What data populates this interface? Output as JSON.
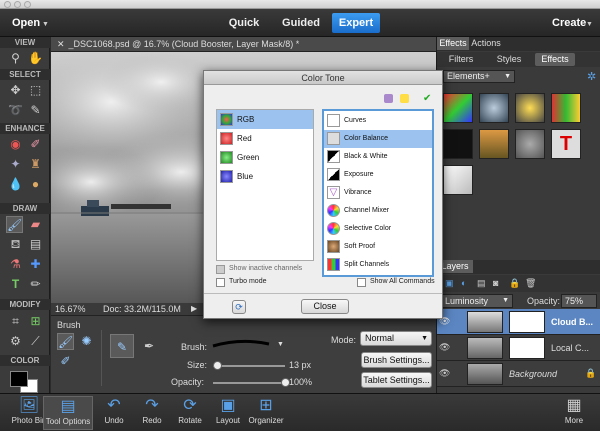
{
  "menubar": {
    "open": "Open",
    "modes": [
      "Quick",
      "Guided",
      "Expert"
    ],
    "create": "Create"
  },
  "toolbar": {
    "sections": [
      "VIEW",
      "SELECT",
      "ENHANCE",
      "DRAW",
      "MODIFY",
      "COLOR"
    ]
  },
  "document": {
    "tab_title": "_DSC1068.psd @ 16.7% (Cloud Booster, Layer Mask/8) *",
    "zoom": "16.67%",
    "doc_info": "Doc: 33.2M/115.0M"
  },
  "options": {
    "tool_name": "Brush",
    "brush_label": "Brush:",
    "size_label": "Size:",
    "size_value": "13 px",
    "size_level_percent": 6,
    "opacity_label": "Opacity:",
    "opacity_value": "100%",
    "opacity_level_percent": 100,
    "mode_label": "Mode:",
    "mode_value": "Normal",
    "brush_settings": "Brush Settings...",
    "tablet_settings": "Tablet Settings..."
  },
  "right_panel": {
    "tabs": [
      "Effects",
      "Actions"
    ],
    "subtabs": [
      "Filters",
      "Styles",
      "Effects"
    ],
    "category": "Elements+",
    "layers_tab": "Layers",
    "blend_mode": "Luminosity",
    "opacity_label": "Opacity:",
    "opacity_value": "75%",
    "layers": [
      {
        "name": "Cloud B..."
      },
      {
        "name": "Local C..."
      },
      {
        "name": "Background"
      }
    ]
  },
  "dialog": {
    "title": "Color Tone",
    "channels": [
      "RGB",
      "Red",
      "Green",
      "Blue"
    ],
    "adjustments": [
      "Curves",
      "Color Balance",
      "Black & White",
      "Exposure",
      "Vibrance",
      "Channel Mixer",
      "Selective Color",
      "Soft Proof",
      "Split Channels"
    ],
    "show_inactive": "Show inactive channels",
    "turbo_mode": "Turbo mode",
    "show_all": "Show All Commands",
    "close": "Close"
  },
  "bottombar": {
    "items": [
      "Photo Bin",
      "Tool Options",
      "Undo",
      "Redo",
      "Rotate",
      "Layout",
      "Organizer"
    ],
    "more": "More"
  },
  "colors": {
    "accent": "#2a7fdc",
    "selection": "#9cc3ef",
    "foreground": "#000000",
    "background": "#ffffff"
  }
}
